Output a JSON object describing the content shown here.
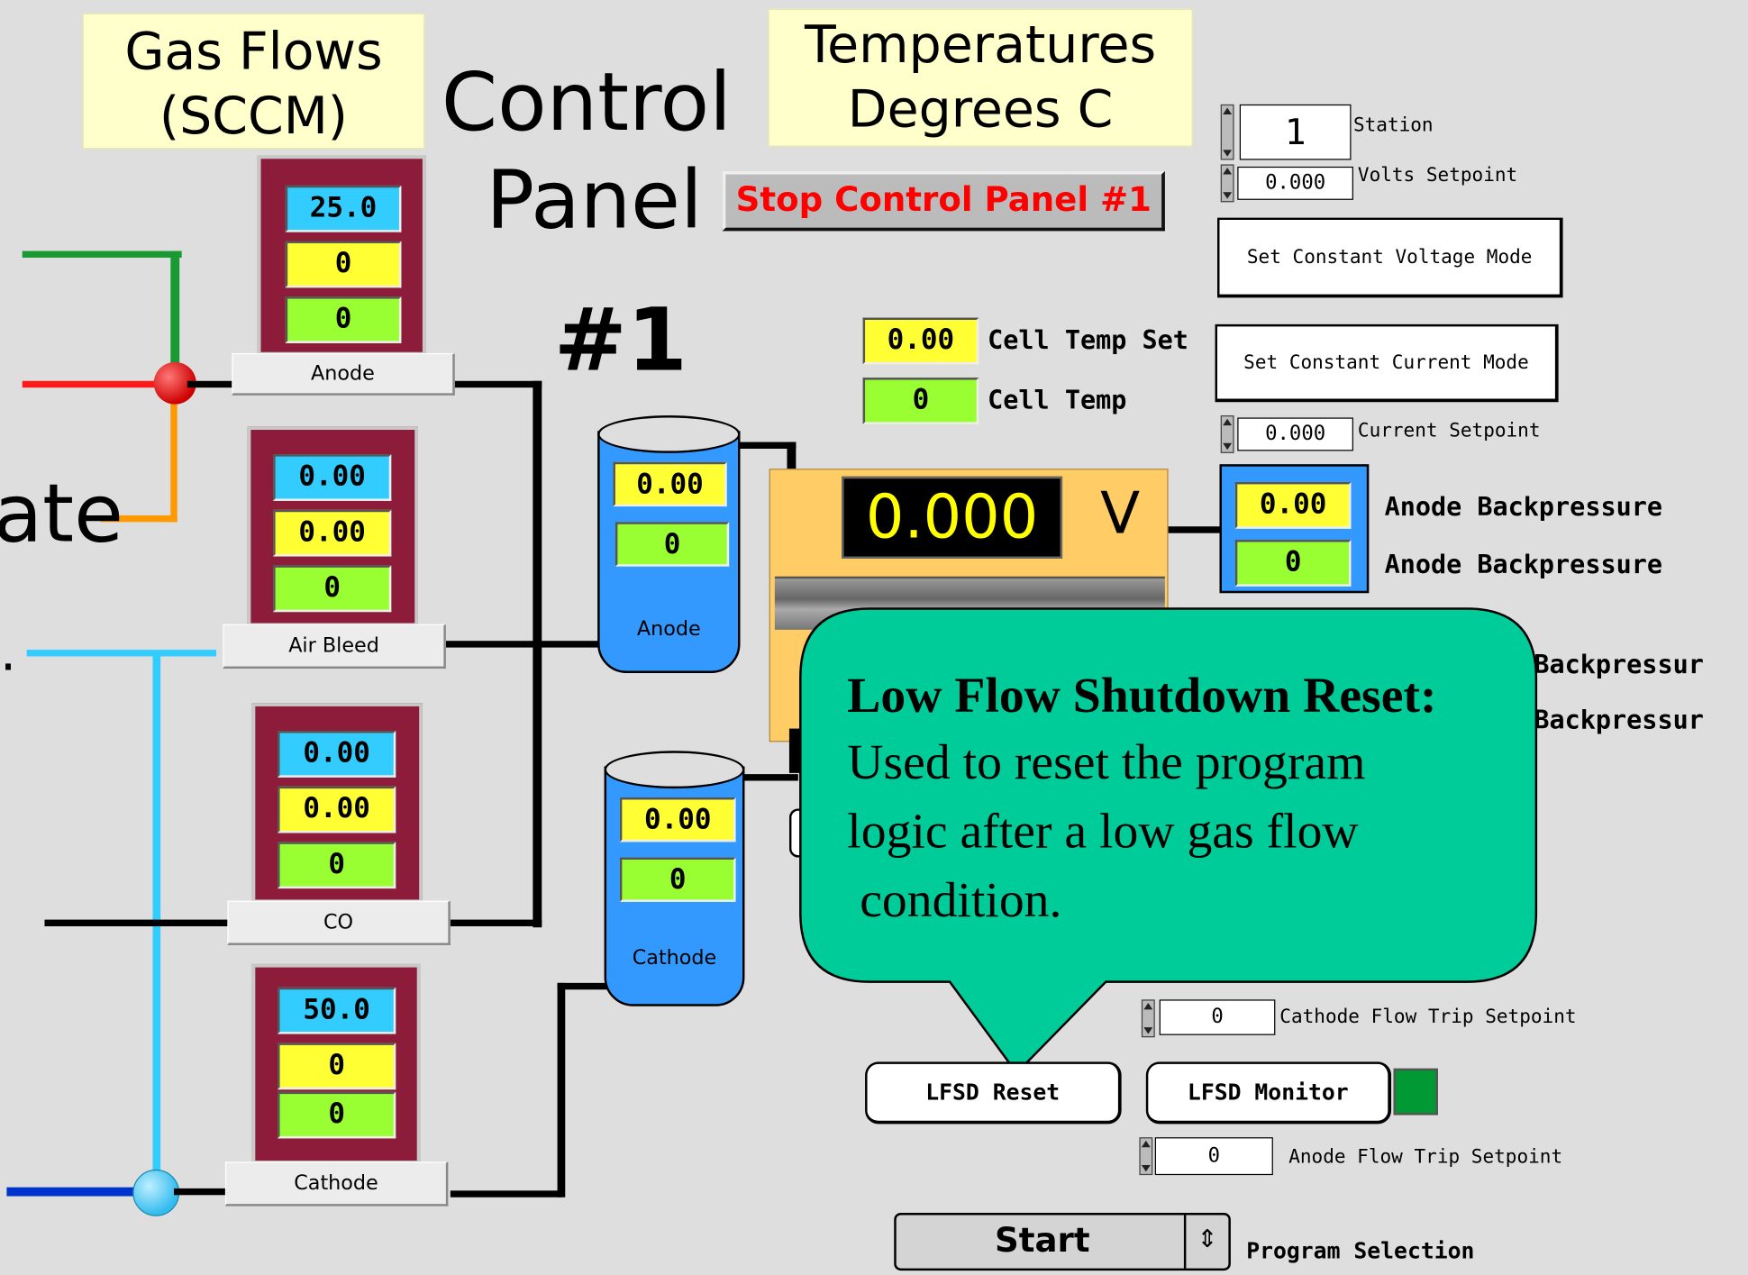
{
  "headers": {
    "gas_flows_line1": "Gas Flows",
    "gas_flows_line2": "(SCCM)",
    "temperatures_line1": "Temperatures",
    "temperatures_line2": "Degrees C"
  },
  "title": {
    "control": "Control",
    "panel": "Panel",
    "number": "#1"
  },
  "partial_text": {
    "ate": "ate"
  },
  "stop_button_label": "Stop Control Panel #1",
  "gas_meters": [
    {
      "setpoint": "25.0",
      "flow": "0",
      "status": "0",
      "label": "Anode"
    },
    {
      "setpoint": "0.00",
      "flow": "0.00",
      "status": "0",
      "label": "Air Bleed"
    },
    {
      "setpoint": "0.00",
      "flow": "0.00",
      "status": "0",
      "label": "CO"
    },
    {
      "setpoint": "50.0",
      "flow": "0",
      "status": "0",
      "label": "Cathode"
    }
  ],
  "tanks": [
    {
      "value_yellow": "0.00",
      "value_green": "0",
      "label": "Anode"
    },
    {
      "value_yellow": "0.00",
      "value_green": "0",
      "label": "Cathode"
    }
  ],
  "cell_temp": {
    "set_value": "0.00",
    "set_label": "Cell Temp Set",
    "value": "0",
    "label": "Cell Temp"
  },
  "station": {
    "value": "1",
    "label": "Station"
  },
  "volts_setpoint": {
    "value": "0.000",
    "label": "Volts Setpoint"
  },
  "current_setpoint": {
    "value": "0.000",
    "label": "Current Setpoint"
  },
  "buttons": {
    "constant_voltage": "Set Constant Voltage Mode",
    "constant_current": "Set Constant Current Mode",
    "lfsd_reset": "LFSD Reset",
    "lfsd_monitor": "LFSD Monitor"
  },
  "voltage_display": {
    "value": "0.000",
    "unit": "V"
  },
  "anode_backpressure": {
    "value_yellow": "0.00",
    "label_yellow": "Anode Backpressure",
    "value_green": "0",
    "label_green": "Anode Backpressure"
  },
  "cathode_backpressure_partial": {
    "label1": "Backpressur",
    "label2": "Backpressur"
  },
  "callout": {
    "title": "Low Flow Shutdown Reset:",
    "body_line1": "Used to reset the program",
    "body_line2": "logic after a low gas flow",
    "body_line3": " condition."
  },
  "cathode_flow_trip": {
    "value": "0",
    "label": "Cathode Flow Trip Setpoint"
  },
  "anode_flow_trip": {
    "value": "0",
    "label": "Anode Flow Trip Setpoint"
  },
  "program_selection": {
    "value": "Start",
    "label": "Program Selection"
  },
  "colors": {
    "background": "#dedede",
    "header_bg": "#ffffcc",
    "meter_frame": "#8c1c3a",
    "cyan_indicator": "#33ccff",
    "yellow_indicator": "#ffff33",
    "green_indicator": "#99ff33",
    "callout_fill": "#00cc99",
    "voltage_panel": "#ffcc66",
    "tank_fill": "#3399ff",
    "stop_text": "#ff0000"
  }
}
